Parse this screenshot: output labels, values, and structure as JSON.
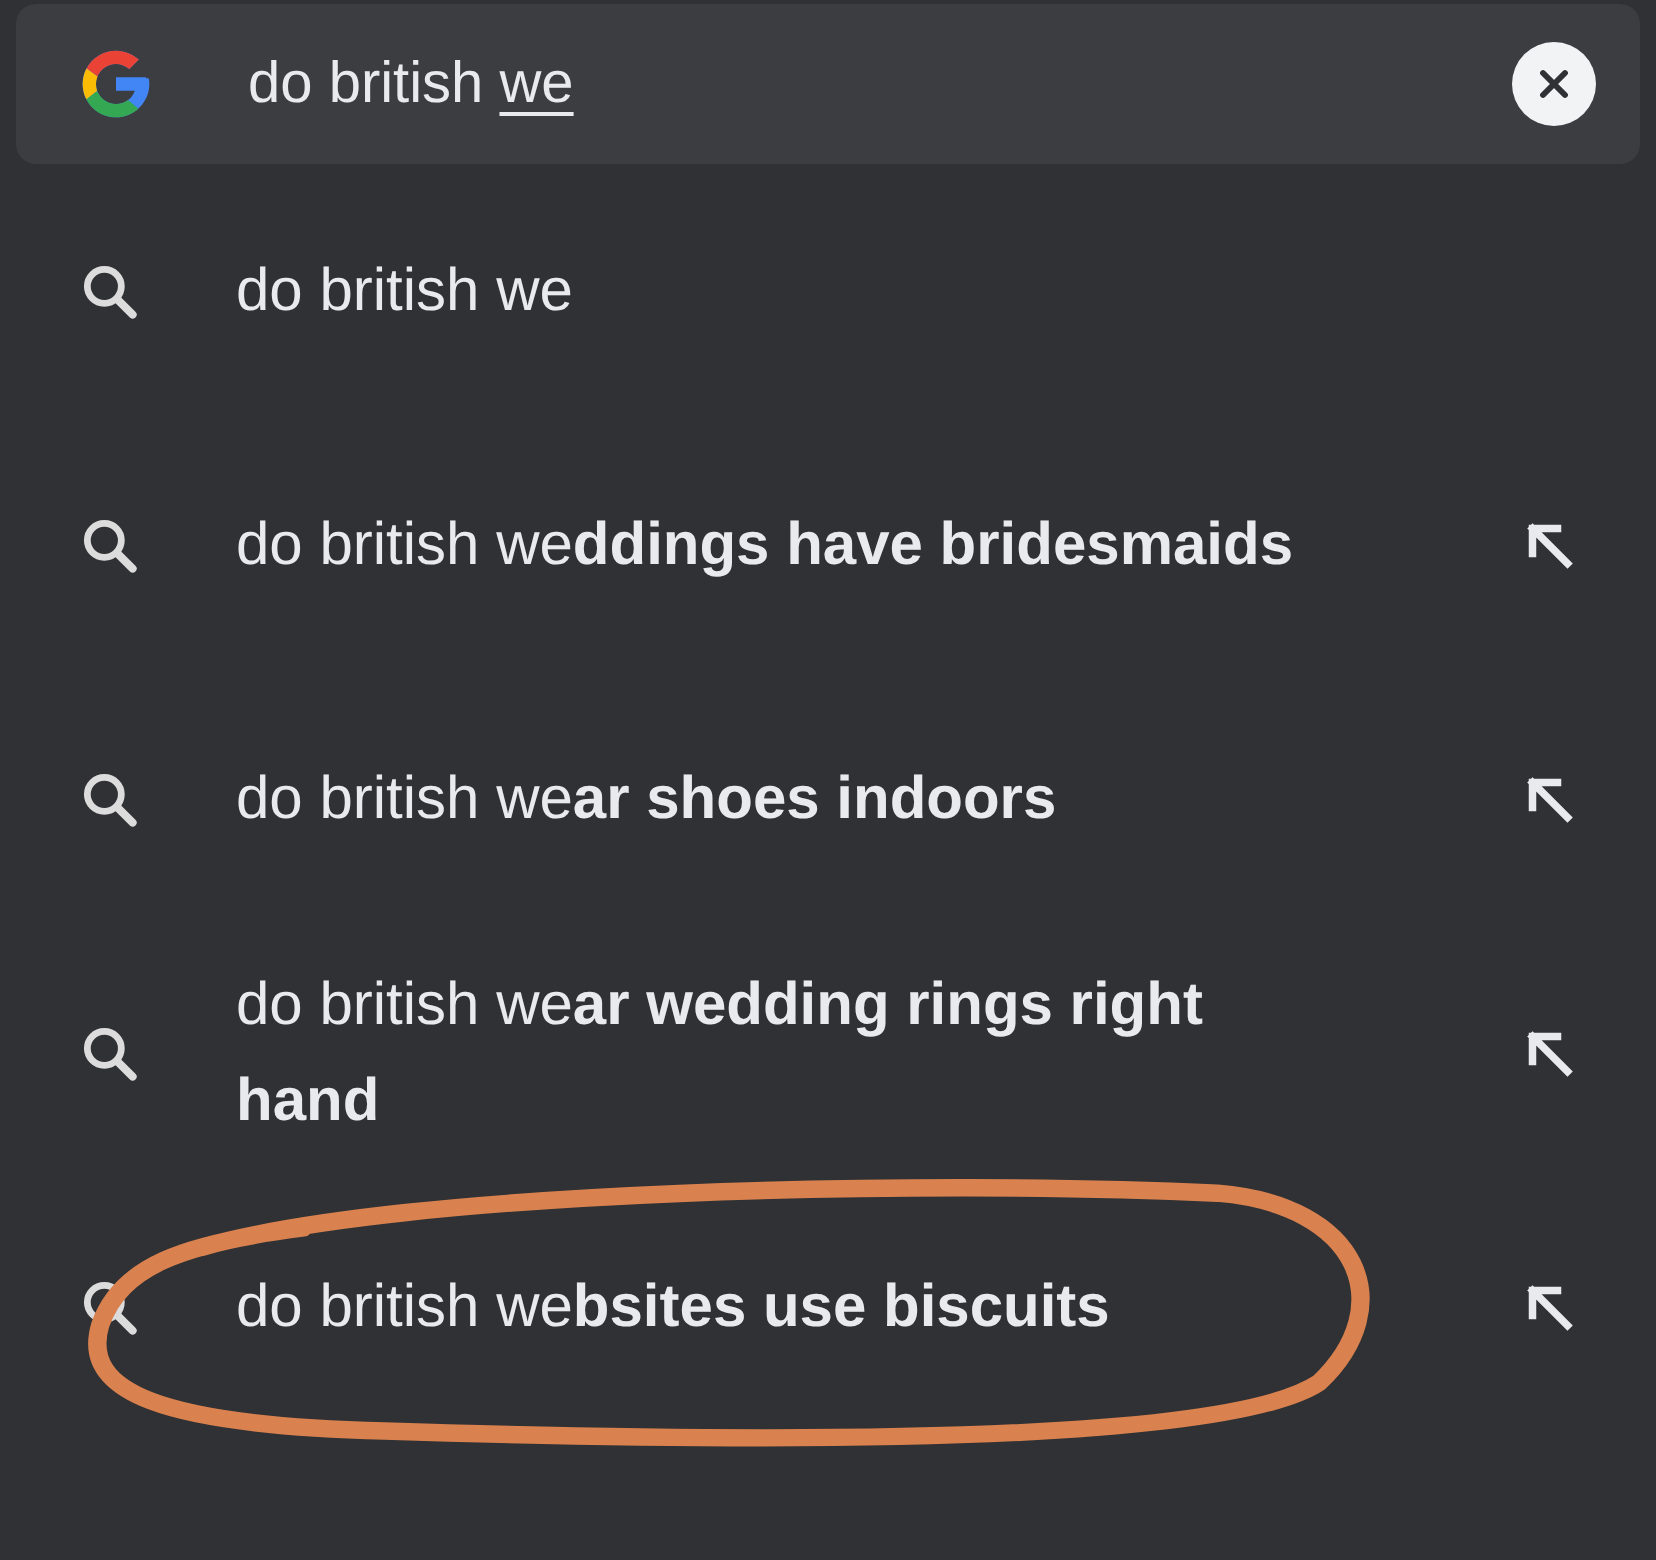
{
  "search": {
    "typed": "do british",
    "composing": "we"
  },
  "suggestions": [
    {
      "text": "do british we",
      "kind": "query",
      "circled": false
    },
    {
      "text": "do british we**ddings have bridesmaids**",
      "kind": "completion",
      "circled": false
    },
    {
      "text": "do british we**ar shoes indoors**",
      "kind": "completion",
      "circled": false
    },
    {
      "text": "do british we**ar wedding rings right hand**",
      "kind": "completion",
      "circled": false
    },
    {
      "text": "do british we**bsites use biscuits**",
      "kind": "completion",
      "circled": true
    }
  ]
}
